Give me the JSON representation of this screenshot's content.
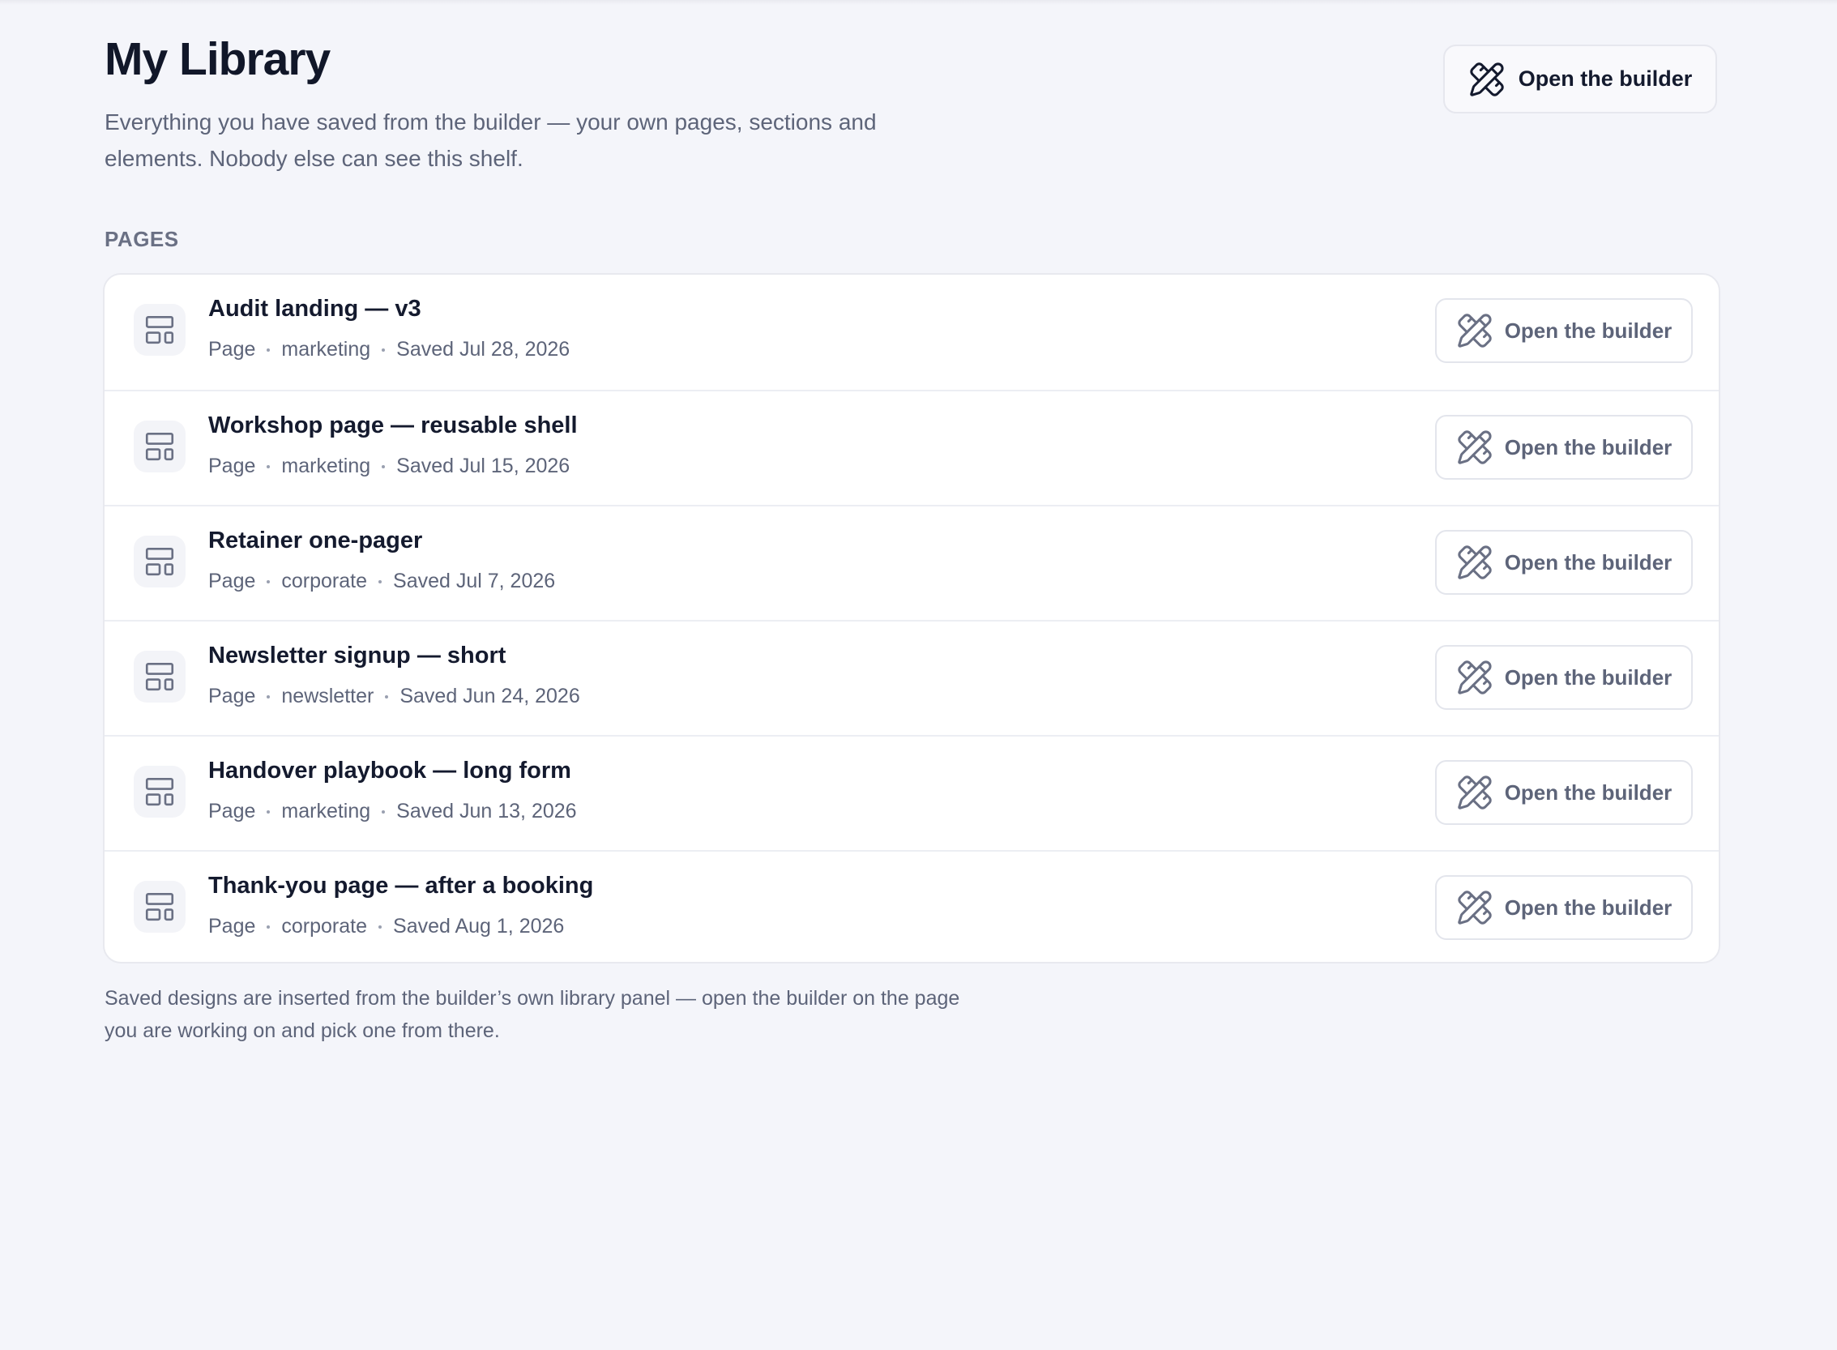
{
  "header": {
    "title": "My Library",
    "subtitle": "Everything you have saved from the builder — your own pages, sections and elements. Nobody else can see this shelf.",
    "open_builder_label": "Open the builder",
    "open_builder_icon": "pencil-ruler-icon"
  },
  "section": {
    "label": "PAGES"
  },
  "pages": [
    {
      "title": "Audit landing — v3",
      "type": "Page",
      "category": "marketing",
      "saved": "Saved Jul 28, 2026",
      "action_label": "Open the builder"
    },
    {
      "title": "Workshop page — reusable shell",
      "type": "Page",
      "category": "marketing",
      "saved": "Saved Jul 15, 2026",
      "action_label": "Open the builder"
    },
    {
      "title": "Retainer one-pager",
      "type": "Page",
      "category": "corporate",
      "saved": "Saved Jul 7, 2026",
      "action_label": "Open the builder"
    },
    {
      "title": "Newsletter signup — short",
      "type": "Page",
      "category": "newsletter",
      "saved": "Saved Jun 24, 2026",
      "action_label": "Open the builder"
    },
    {
      "title": "Handover playbook — long form",
      "type": "Page",
      "category": "marketing",
      "saved": "Saved Jun 13, 2026",
      "action_label": "Open the builder"
    },
    {
      "title": "Thank-you page — after a booking",
      "type": "Page",
      "category": "corporate",
      "saved": "Saved Aug 1, 2026",
      "action_label": "Open the builder"
    }
  ],
  "footnote": "Saved designs are inserted from the builder’s own library panel — open the builder on the page you are working on and pick one from there.",
  "colors": {
    "background": "#f4f5fa",
    "text": "#141a2e",
    "muted": "#5d6479",
    "border": "#e8e9ef"
  }
}
